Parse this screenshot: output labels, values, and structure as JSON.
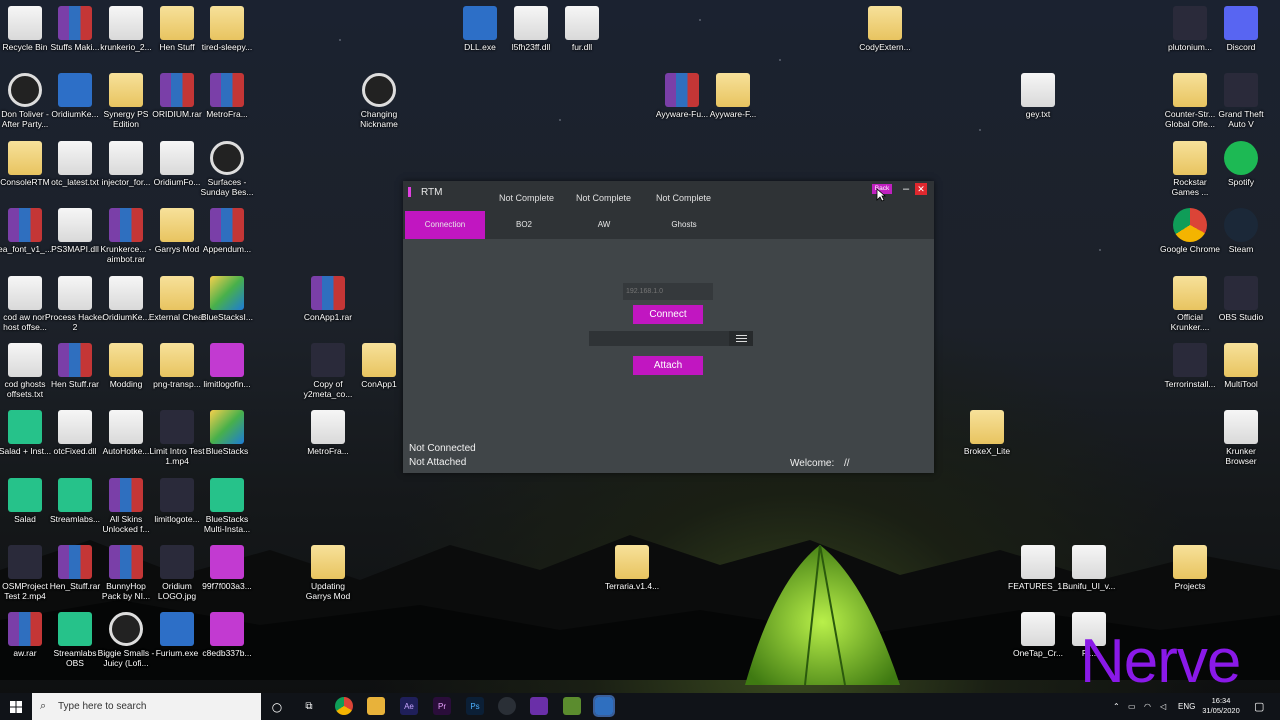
{
  "desktop_icons": [
    {
      "label": "Recycle Bin",
      "icon": "recycle-bin-icon",
      "kind": "file"
    },
    {
      "label": "Stuffs Maki...",
      "icon": "archive-icon",
      "kind": "rar"
    },
    {
      "label": "krunkerio_2...",
      "icon": "installer-icon",
      "kind": "dll"
    },
    {
      "label": "Hen Stuff",
      "icon": "folder-icon",
      "kind": "folder"
    },
    {
      "label": "tired-sleepy...",
      "icon": "emoji-image-icon",
      "kind": "folder"
    },
    {
      "label": "DLL.exe",
      "icon": "exe-icon",
      "kind": "exe"
    },
    {
      "label": "l5fh23ff.dll",
      "icon": "dll-icon",
      "kind": "dll"
    },
    {
      "label": "fur.dll",
      "icon": "dll-icon",
      "kind": "dll"
    },
    {
      "label": "CodyExtern...",
      "icon": "archive-folder-icon",
      "kind": "folder"
    },
    {
      "label": "plutonium...",
      "icon": "plutonium-icon",
      "kind": "dark"
    },
    {
      "label": "Discord",
      "icon": "discord-icon",
      "kind": "discord"
    },
    {
      "label": "Don Toliver - After Party...",
      "icon": "media-file-icon",
      "kind": "media"
    },
    {
      "label": "OridiumKe...",
      "icon": "exe-icon",
      "kind": "exe"
    },
    {
      "label": "Synergy PS Edition",
      "icon": "archive-folder-icon",
      "kind": "folder"
    },
    {
      "label": "ORIDIUM.rar",
      "icon": "archive-icon",
      "kind": "rar"
    },
    {
      "label": "MetroFra...",
      "icon": "archive-icon",
      "kind": "rar"
    },
    {
      "label": "Changing Nickname",
      "icon": "vlc-icon",
      "kind": "media"
    },
    {
      "label": "Ayyware-Fu...",
      "icon": "archive-icon",
      "kind": "rar"
    },
    {
      "label": "Ayyware-F...",
      "icon": "archive-folder-icon",
      "kind": "folder"
    },
    {
      "label": "gey.txt",
      "icon": "text-file-icon",
      "kind": "file"
    },
    {
      "label": "Counter-Str... Global Offe...",
      "icon": "csgo-icon",
      "kind": "folder"
    },
    {
      "label": "Grand Theft Auto V",
      "icon": "gta-icon",
      "kind": "dark"
    },
    {
      "label": "ConsoleRTM",
      "icon": "archive-folder-icon",
      "kind": "folder"
    },
    {
      "label": "otc_latest.txt",
      "icon": "text-file-icon",
      "kind": "file"
    },
    {
      "label": "injector_for...",
      "icon": "installer-icon",
      "kind": "dll"
    },
    {
      "label": "OridiumFo...",
      "icon": "text-file-icon",
      "kind": "file"
    },
    {
      "label": "Surfaces - Sunday Bes...",
      "icon": "media-file-icon",
      "kind": "media"
    },
    {
      "label": "Rockstar Games ...",
      "icon": "rockstar-icon",
      "kind": "folder"
    },
    {
      "label": "Spotify",
      "icon": "spotify-icon",
      "kind": "spotify"
    },
    {
      "label": "ea_font_v1_...",
      "icon": "archive-icon",
      "kind": "rar"
    },
    {
      "label": "PS3MAPI.dll",
      "icon": "dll-icon",
      "kind": "dll"
    },
    {
      "label": "Krunkerce... - aimbot.rar",
      "icon": "archive-icon",
      "kind": "rar"
    },
    {
      "label": "Garrys Mod",
      "icon": "garrys-mod-icon",
      "kind": "folder"
    },
    {
      "label": "Appendum...",
      "icon": "archive-icon",
      "kind": "rar"
    },
    {
      "label": "Google Chrome",
      "icon": "chrome-icon",
      "kind": "chrome"
    },
    {
      "label": "Steam",
      "icon": "steam-icon",
      "kind": "steam"
    },
    {
      "label": "cod aw non host offse...",
      "icon": "text-file-icon",
      "kind": "file"
    },
    {
      "label": "Process Hacker 2",
      "icon": "process-hacker-icon",
      "kind": "dll"
    },
    {
      "label": "OridiumKe...",
      "icon": "dll-icon",
      "kind": "dll"
    },
    {
      "label": "External Cheat",
      "icon": "archive-folder-icon",
      "kind": "folder"
    },
    {
      "label": "BlueStacksI...",
      "icon": "bluestacks-icon",
      "kind": "bs"
    },
    {
      "label": "ConApp1.rar",
      "icon": "archive-icon",
      "kind": "rar"
    },
    {
      "label": "Official Krunker....",
      "icon": "krunker-icon",
      "kind": "folder"
    },
    {
      "label": "OBS Studio",
      "icon": "obs-icon",
      "kind": "dark"
    },
    {
      "label": "cod ghosts offsets.txt",
      "icon": "text-file-icon",
      "kind": "file"
    },
    {
      "label": "Hen Stuff.rar",
      "icon": "archive-icon",
      "kind": "rar"
    },
    {
      "label": "Modding",
      "icon": "folder-icon",
      "kind": "folder"
    },
    {
      "label": "png-transp...",
      "icon": "emoji-image-icon",
      "kind": "folder"
    },
    {
      "label": "limitlogofin...",
      "icon": "image-icon",
      "kind": "magenta"
    },
    {
      "label": "Copy of y2meta_co...",
      "icon": "video-file-icon",
      "kind": "dark"
    },
    {
      "label": "ConApp1",
      "icon": "archive-folder-icon",
      "kind": "folder"
    },
    {
      "label": "Terrorinstall...",
      "icon": "terror-icon",
      "kind": "dark"
    },
    {
      "label": "MultiTool",
      "icon": "archive-folder-icon",
      "kind": "folder"
    },
    {
      "label": "Salad + Inst...",
      "icon": "salad-icon",
      "kind": "green"
    },
    {
      "label": "otcFixed.dll",
      "icon": "dll-icon",
      "kind": "dll"
    },
    {
      "label": "AutoHotke...",
      "icon": "autohotkey-icon",
      "kind": "dll"
    },
    {
      "label": "Limit Intro Test 1.mp4",
      "icon": "video-file-icon",
      "kind": "dark"
    },
    {
      "label": "BlueStacks",
      "icon": "bluestacks-icon",
      "kind": "bs"
    },
    {
      "label": "MetroFra...",
      "icon": "dll-icon",
      "kind": "dll"
    },
    {
      "label": "BrokeX_Lite",
      "icon": "archive-folder-icon",
      "kind": "folder"
    },
    {
      "label": "Krunker Browser",
      "icon": "text-file-icon",
      "kind": "file"
    },
    {
      "label": "Salad",
      "icon": "salad-icon",
      "kind": "green"
    },
    {
      "label": "Streamlabs...",
      "icon": "streamlabs-icon",
      "kind": "green"
    },
    {
      "label": "All Skins Unlocked f...",
      "icon": "archive-icon",
      "kind": "rar"
    },
    {
      "label": "limitlogote...",
      "icon": "video-file-icon",
      "kind": "dark"
    },
    {
      "label": "BlueStacks Multi-Insta...",
      "icon": "bluestacks-multi-icon",
      "kind": "green"
    },
    {
      "label": "OSMProject Test 2.mp4",
      "icon": "video-file-icon",
      "kind": "dark"
    },
    {
      "label": "Hen_Stuff.rar",
      "icon": "archive-icon",
      "kind": "rar"
    },
    {
      "label": "BunnyHop Pack by NI...",
      "icon": "archive-icon",
      "kind": "rar"
    },
    {
      "label": "Oridium LOGO.jpg",
      "icon": "image-icon",
      "kind": "dark"
    },
    {
      "label": "99f7f003a3...",
      "icon": "image-icon",
      "kind": "magenta"
    },
    {
      "label": "Updating Garrys Mod",
      "icon": "garrys-mod-icon",
      "kind": "folder"
    },
    {
      "label": "Terraria.v1.4...",
      "icon": "archive-folder-icon",
      "kind": "folder"
    },
    {
      "label": "FEATURES_1...",
      "icon": "dll-icon",
      "kind": "dll"
    },
    {
      "label": "Bunifu_UI_v...",
      "icon": "dll-icon",
      "kind": "dll"
    },
    {
      "label": "Projects",
      "icon": "archive-folder-icon",
      "kind": "folder"
    },
    {
      "label": "aw.rar",
      "icon": "archive-icon",
      "kind": "rar"
    },
    {
      "label": "Streamlabs OBS",
      "icon": "streamlabs-icon",
      "kind": "green"
    },
    {
      "label": "Biggie Smalls - Juicy (Lofi...",
      "icon": "media-file-icon",
      "kind": "media"
    },
    {
      "label": "Furium.exe",
      "icon": "exe-icon",
      "kind": "exe"
    },
    {
      "label": "c8edb337b...",
      "icon": "image-icon",
      "kind": "magenta"
    },
    {
      "label": "OneTap_Cr...",
      "icon": "dll-icon",
      "kind": "dll"
    },
    {
      "label": "Fl...",
      "icon": "dll-icon",
      "kind": "dll"
    }
  ],
  "rtm": {
    "title": "RTM",
    "status_top": [
      "Not Complete",
      "Not Complete",
      "Not Complete"
    ],
    "back_label": "Back",
    "minimize_label": "–",
    "close_label": "✕",
    "tabs": [
      "Connection",
      "BO2",
      "AW",
      "Ghosts"
    ],
    "ip_placeholder": "192.168.1.0",
    "connect_label": "Connect",
    "attach_label": "Attach",
    "connection_status": "Not Connected",
    "attach_status": "Not Attached",
    "welcome_label": "Welcome:",
    "welcome_value": "//",
    "accent": "#c116c1"
  },
  "taskbar": {
    "search_placeholder": "Type here to search",
    "language": "ENG",
    "time": "16:34",
    "date": "31/05/2020",
    "apps": [
      "chrome-icon",
      "file-explorer-icon",
      "after-effects-icon",
      "premiere-icon",
      "photoshop-icon",
      "steam-tray-icon",
      "visual-studio-icon",
      "minecraft-icon",
      "winrar-icon"
    ]
  },
  "watermark": "Nerve"
}
